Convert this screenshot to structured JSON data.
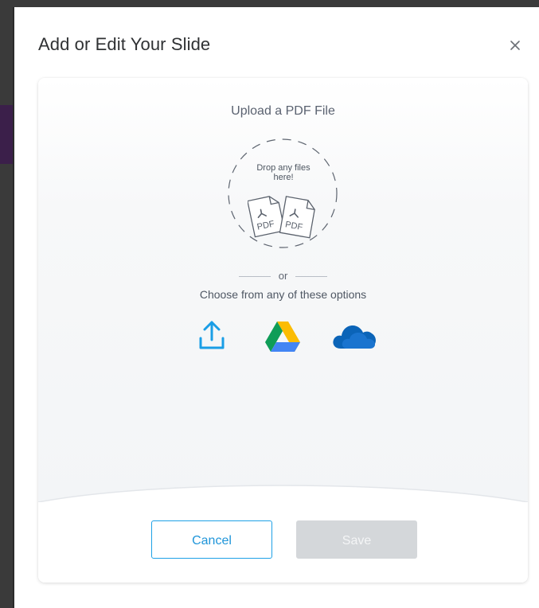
{
  "dialog": {
    "title": "Add or Edit Your Slide",
    "close_icon": "close-icon"
  },
  "upload": {
    "heading": "Upload a PDF File",
    "drop_text": "Drop any files here!",
    "pdf_labels": [
      "PDF",
      "PDF"
    ],
    "or_text": "or",
    "choose_text": "Choose from any of these options",
    "options": [
      {
        "name": "upload-from-device-icon"
      },
      {
        "name": "google-drive-icon"
      },
      {
        "name": "onedrive-icon"
      }
    ]
  },
  "footer": {
    "cancel_label": "Cancel",
    "save_label": "Save"
  },
  "colors": {
    "accent": "#1ea1e6",
    "save_disabled": "#d4d7da"
  }
}
